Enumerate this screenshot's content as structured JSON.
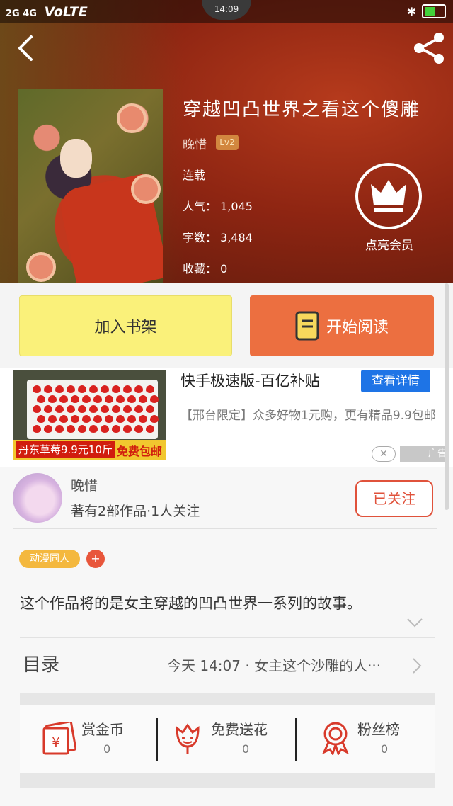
{
  "status_bar": {
    "signal": "2G 4G",
    "volte": "VoLTE",
    "time": "14:09"
  },
  "book": {
    "title": "穿越凹凸世界之看这个傻雕",
    "author": "晚惜",
    "level": "Lv2",
    "status": "连载",
    "popularity": "人气： 1,045",
    "word_count": "字数： 3,484",
    "favorites": "收藏： 0",
    "vip_label": "点亮会员"
  },
  "actions": {
    "add_shelf": "加入书架",
    "start_read": "开始阅读"
  },
  "ad": {
    "title": "快手极速版-百亿补贴",
    "button": "查看详情",
    "desc": "【邢台限定】众多好物1元购，更有精品9.9包邮",
    "image_price": "丹东草莓9.9元10斤",
    "image_free": "免费包邮",
    "close": "✕",
    "tag": "广告"
  },
  "author_card": {
    "name": "晚惜",
    "stats": "著有2部作品·1人关注",
    "follow_label": "已关注"
  },
  "tags": [
    "动漫同人"
  ],
  "tag_add": "+",
  "description": "这个作品将的是女主穿越的凹凸世界一系列的故事。",
  "toc": {
    "label": "目录",
    "latest": "今天 14:07 · 女主这个沙雕的人···"
  },
  "stats_row": [
    {
      "label": "赏金币",
      "value": "0",
      "icon": "red-envelope-icon"
    },
    {
      "label": "免费送花",
      "value": "0",
      "icon": "flower-icon"
    },
    {
      "label": "粉丝榜",
      "value": "0",
      "icon": "medal-icon"
    }
  ],
  "colors": {
    "accent": "#ec6f40",
    "shelf": "#faf17a",
    "ad_button": "#1e74e6",
    "red": "#e0523b"
  }
}
